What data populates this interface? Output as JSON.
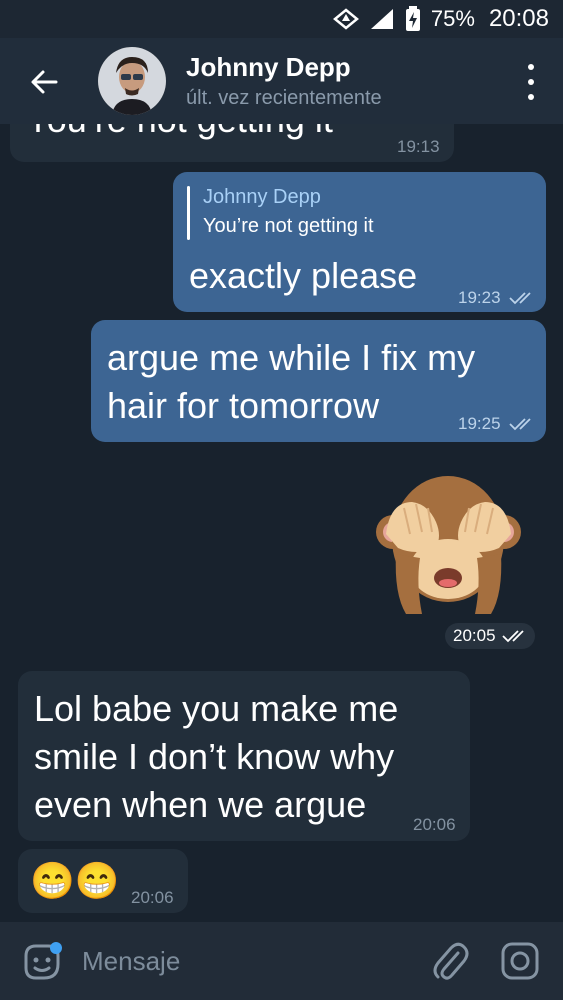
{
  "status_bar": {
    "battery": "75%",
    "time": "20:08",
    "icons": [
      "data-saver-icon",
      "signal-icon",
      "battery-charging-icon"
    ]
  },
  "header": {
    "contact_name": "Johnny Depp",
    "last_seen": "últ. vez recientemente",
    "icons": [
      "back-arrow-icon",
      "more-vert-icon"
    ]
  },
  "messages": [
    {
      "direction": "in",
      "text": "You’re not getting it",
      "time": "19:13"
    },
    {
      "direction": "out",
      "reply_to_name": "Johnny Depp",
      "reply_to_text": "You’re not getting it",
      "text": "exactly please",
      "time": "19:23",
      "read": true
    },
    {
      "direction": "out",
      "text_line1": "argue me while I fix my",
      "text_line2": "hair for tomorrow",
      "time": "19:25",
      "read": true
    },
    {
      "direction": "out",
      "sticker": "see-no-evil-monkey",
      "time": "20:05",
      "read": true
    },
    {
      "direction": "in",
      "text_line1": "Lol babe you make me",
      "text_line2": "smile I don’t know why",
      "text_line3": "even when we argue",
      "time": "20:06"
    },
    {
      "direction": "in",
      "emoji": "😁😁",
      "time": "20:06"
    }
  ],
  "input": {
    "placeholder": "Mensaje",
    "icons": [
      "sticker-emoji-icon",
      "attach-icon",
      "camera-icon"
    ]
  },
  "colors": {
    "background": "#18222d",
    "header": "#212d3b",
    "incoming_bubble": "#222e3a",
    "outgoing_bubble": "#3d6593",
    "reply_name": "#a9d1f7"
  }
}
